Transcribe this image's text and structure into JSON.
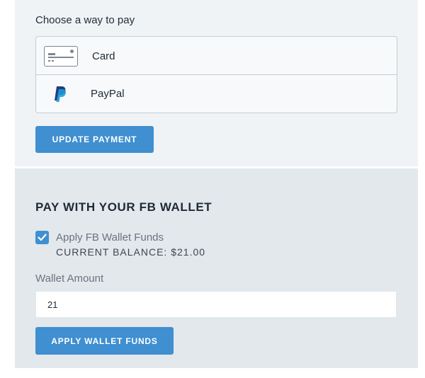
{
  "payment": {
    "heading": "Choose a way to pay",
    "methods": [
      {
        "label": "Card",
        "icon": "credit-card-icon"
      },
      {
        "label": "PayPal",
        "icon": "paypal-icon"
      }
    ],
    "update_button": "UPDATE PAYMENT"
  },
  "wallet": {
    "heading": "PAY WITH YOUR FB WALLET",
    "apply_checkbox_label": "Apply FB Wallet Funds",
    "apply_checked": true,
    "balance": "CURRENT BALANCE: $21.00",
    "amount_label": "Wallet Amount",
    "amount_value": "21",
    "apply_button": "APPLY WALLET FUNDS"
  },
  "colors": {
    "accent": "#3f8fd1",
    "panel_top": "#f0f3f6",
    "panel_bottom": "#e2e8ec",
    "paypal_dark": "#253b80",
    "paypal_light": "#179bd7"
  }
}
